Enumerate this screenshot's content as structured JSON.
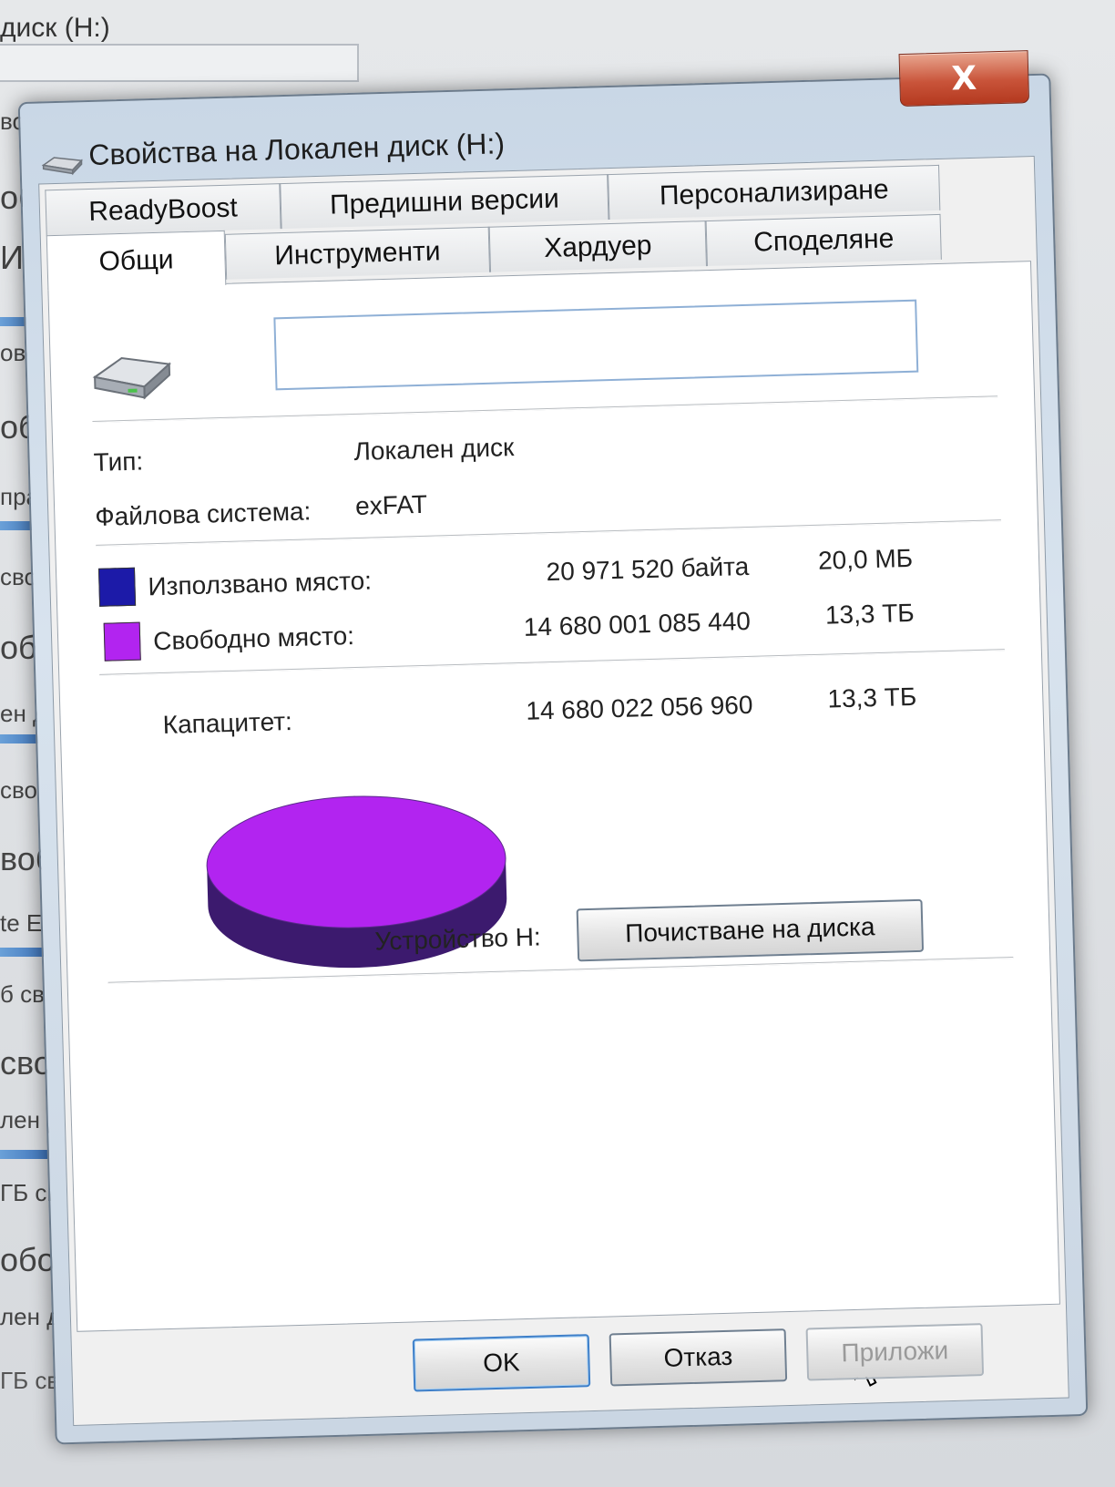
{
  "background": {
    "title": "диск (H:)",
    "items": [
      "во",
      "об",
      "И (",
      "ово",
      "об",
      "праг",
      "сво",
      "обо",
      "ен ди",
      "сво",
      "вобо",
      "te Exp",
      "б сво",
      "свобо",
      "лен ди",
      "ГБ сво",
      "обод",
      "лен ди"
    ],
    "bottom_text": "ГБ сво"
  },
  "dialog": {
    "title": "Свойства на Локален диск (H:)",
    "close_glyph": "X",
    "tabs_back": [
      "ReadyBoost",
      "Предишни версии",
      "Персонализиране"
    ],
    "tabs_front": [
      "Общи",
      "Инструменти",
      "Хардуер",
      "Споделяне"
    ],
    "active_tab": "Общи",
    "volume_label_value": "",
    "type_label": "Тип:",
    "type_value": "Локален диск",
    "fs_label": "Файлова система:",
    "fs_value": "exFAT",
    "used": {
      "label": "Използвано място:",
      "bytes": "20 971 520 байта",
      "size": "20,0 МБ",
      "color": "#1c1aa8"
    },
    "free": {
      "label": "Свободно място:",
      "bytes": "14 680 001 085 440",
      "size": "13,3 ТБ",
      "color": "#b224f0"
    },
    "capacity": {
      "label": "Капацитет:",
      "bytes": "14 680 022 056 960",
      "size": "13,3 ТБ"
    },
    "drive_label": "Устройство H:",
    "cleanup_button": "Почистване на диска",
    "ok_button": "OK",
    "cancel_button": "Отказ",
    "apply_button": "Приложи"
  },
  "chart_data": {
    "type": "pie",
    "series": [
      {
        "name": "Използвано място",
        "value": 20971520,
        "color": "#1c1aa8"
      },
      {
        "name": "Свободно място",
        "value": 14680001085440,
        "color": "#b224f0"
      }
    ]
  }
}
